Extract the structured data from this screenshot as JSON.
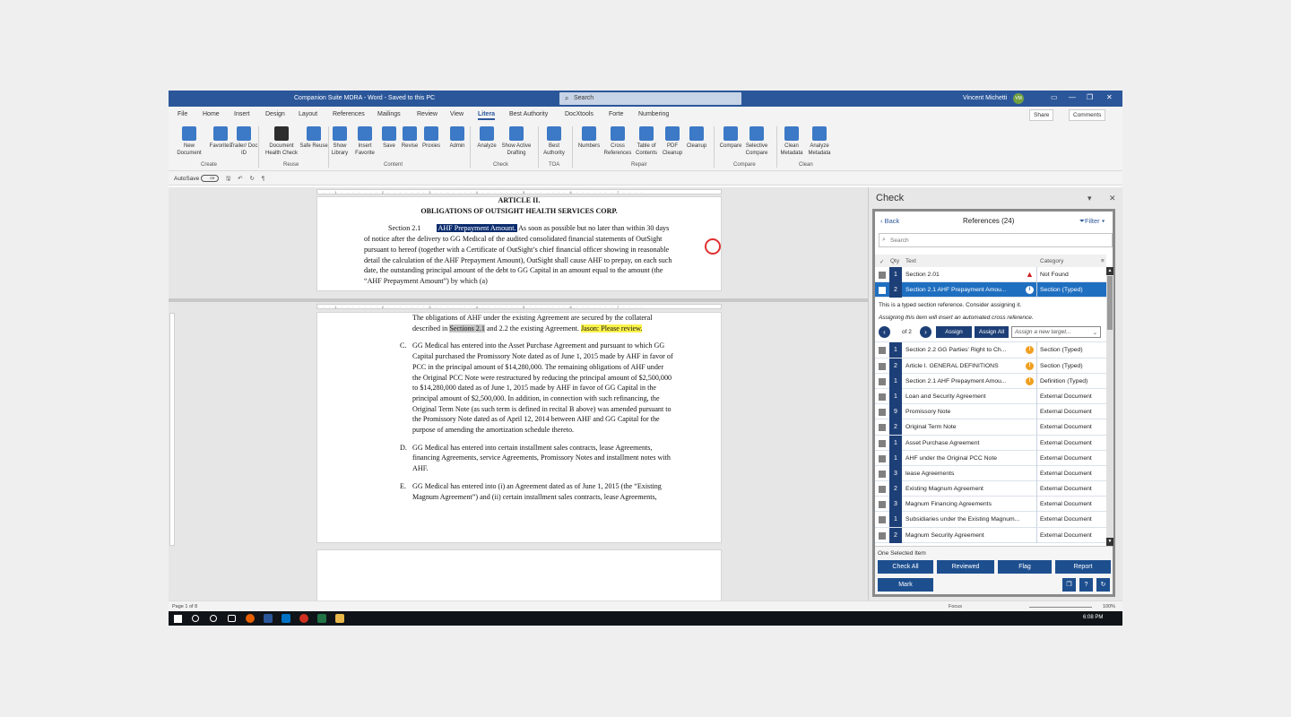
{
  "titlebar": {
    "title": "Companion Suite MDRA - Word - Saved to this PC",
    "search_placeholder": "Search",
    "user": "Vincent Michetti",
    "initials": "VM"
  },
  "tabs": [
    "File",
    "Home",
    "Insert",
    "Design",
    "Layout",
    "References",
    "Mailings",
    "Review",
    "View",
    "Litera",
    "Best Authority",
    "DocXtools",
    "Forte",
    "Numbering"
  ],
  "active_tab": "Litera",
  "share_label": "Share",
  "comments_label": "Comments",
  "ribbon": {
    "buttons": [
      "New Document",
      "Favorites",
      "Trailer/ Doc ID",
      "Document Health Check",
      "Safe Reuse",
      "Show Library",
      "Insert Favorite",
      "Save",
      "Revise",
      "Proxies",
      "Admin",
      "Analyze",
      "Show Active Drafting",
      "Best Authority",
      "Numbers",
      "Cross References",
      "Table of Contents",
      "PDF Cleanup",
      "Cleanup",
      "Compare",
      "Selective Compare",
      "Clean Metadata",
      "Analyze Metadata"
    ],
    "groups": [
      "Create",
      "Reuse",
      "Content",
      "Check",
      "TOA",
      "Repair",
      "Compare",
      "Clean"
    ]
  },
  "qat": {
    "autosave": "AutoSave",
    "toggle": "Off"
  },
  "doc": {
    "article": "ARTICLE II.",
    "heading": "OBLIGATIONS OF OUTSIGHT HEALTH SERVICES CORP.",
    "sec_label": "Section 2.1",
    "sec_highlight": "AHF Prepayment Amount.",
    "sec_rest": " As soon as possible but no later than within 30 days of notice after the delivery to GG Medical of the audited consolidated financial statements of OutSight pursuant to hereof (together with a Certificate of OutSight’s chief financial officer showing in reasonable detail the calculation of the AHF Prepayment Amount), OutSight shall cause AHF to prepay, on each such date, the outstanding principal amount of the debt to GG Capital in an amount equal to the amount (the “AHF Prepayment Amount”) by which (a)",
    "p2a": "The obligations of AHF under the existing Agreement are secured by the collateral described in ",
    "p2_hl": "Sections 2.1",
    "p2b": " and 2.2 the existing Agreement. ",
    "p2_comment": "Jason: Please review.",
    "c_marker": "C.",
    "c_text": "GG Medical has entered into the Asset Purchase Agreement and pursuant to which GG Capital purchased the Promissory Note dated as of June 1, 2015 made by AHF in favor of PCC in the principal amount of $14,280,000.  The remaining obligations of AHF under the Original PCC Note were restructured by reducing the principal amount of $2,500,000 to $14,280,000 dated as of June 1, 2015 made by AHF in favor of GG Capital in the principal amount of $2,500,000.  In addition, in connection with such refinancing, the Original Term Note (as such term is defined in recital B above) was amended pursuant to the Promissory Note dated as of April 12, 2014 between AHF and GG Capital for the purpose of amending the amortization schedule thereto.",
    "d_marker": "D.",
    "d_text": "GG Medical has entered into certain installment sales contracts, lease Agreements, financing Agreements, service Agreements, Promissory Notes and installment notes with AHF.",
    "e_marker": "E.",
    "e_text": "GG Medical has entered into (i) an Agreement dated as of June 1, 2015 (the “Existing Magnum Agreement”) and (ii) certain installment sales contracts, lease Agreements,"
  },
  "status": {
    "page": "Page 1 of 8",
    "focus": "Focus",
    "zoom": "100%",
    "time": "6:08 PM"
  },
  "panel": {
    "title": "Check",
    "back": "Back",
    "references": "References (24)",
    "filter": "Filter",
    "search_placeholder": "Search",
    "col_qty": "Qty",
    "col_text": "Text",
    "col_category": "Category",
    "rows_top": [
      {
        "qty": "1",
        "text": "Section 2.01",
        "category": "Not Found",
        "warn": "red"
      },
      {
        "qty": "2",
        "text": "Section 2.1   AHF Prepayment Amou...",
        "category": "Section (Typed)",
        "warn": "info",
        "selected": true
      }
    ],
    "detail": {
      "line1": "This is a typed section reference. Consider assigning it.",
      "line2": "Assigning this item will insert an automated cross reference.",
      "counter": "of 2",
      "assign": "Assign",
      "assign_all": "Assign All",
      "target": "Assign a new target..."
    },
    "rows_bottom": [
      {
        "qty": "1",
        "text": "Section 2.2   GG Parties' Right to Ch...",
        "category": "Section (Typed)",
        "warn": "orange"
      },
      {
        "qty": "2",
        "text": "Article I.   GENERAL DEFINITIONS",
        "category": "Section (Typed)",
        "warn": "orange"
      },
      {
        "qty": "1",
        "text": "Section 2.1   AHF Prepayment Amou...",
        "category": "Definition (Typed)",
        "warn": "orange"
      },
      {
        "qty": "1",
        "text": "Loan and Security Agreement",
        "category": "External Document"
      },
      {
        "qty": "9",
        "text": "Promissory Note",
        "category": "External Document"
      },
      {
        "qty": "2",
        "text": "Original Term Note",
        "category": "External Document"
      },
      {
        "qty": "1",
        "text": "Asset Purchase Agreement",
        "category": "External Document"
      },
      {
        "qty": "1",
        "text": "AHF under the Original PCC Note",
        "category": "External Document"
      },
      {
        "qty": "3",
        "text": "lease Agreements",
        "category": "External Document"
      },
      {
        "qty": "2",
        "text": "Existing Magnum Agreement",
        "category": "External Document"
      },
      {
        "qty": "3",
        "text": "Magnum Financing Agreements",
        "category": "External Document"
      },
      {
        "qty": "1",
        "text": "Subsidiaries under the Existing Magnum...",
        "category": "External Document"
      },
      {
        "qty": "2",
        "text": "Magnum Security Agreement",
        "category": "External Document"
      }
    ],
    "footer": {
      "selected": "One Selected Item",
      "check_all": "Check All",
      "reviewed": "Reviewed",
      "flag": "Flag",
      "report": "Report",
      "mark": "Mark",
      "help": "?"
    }
  }
}
